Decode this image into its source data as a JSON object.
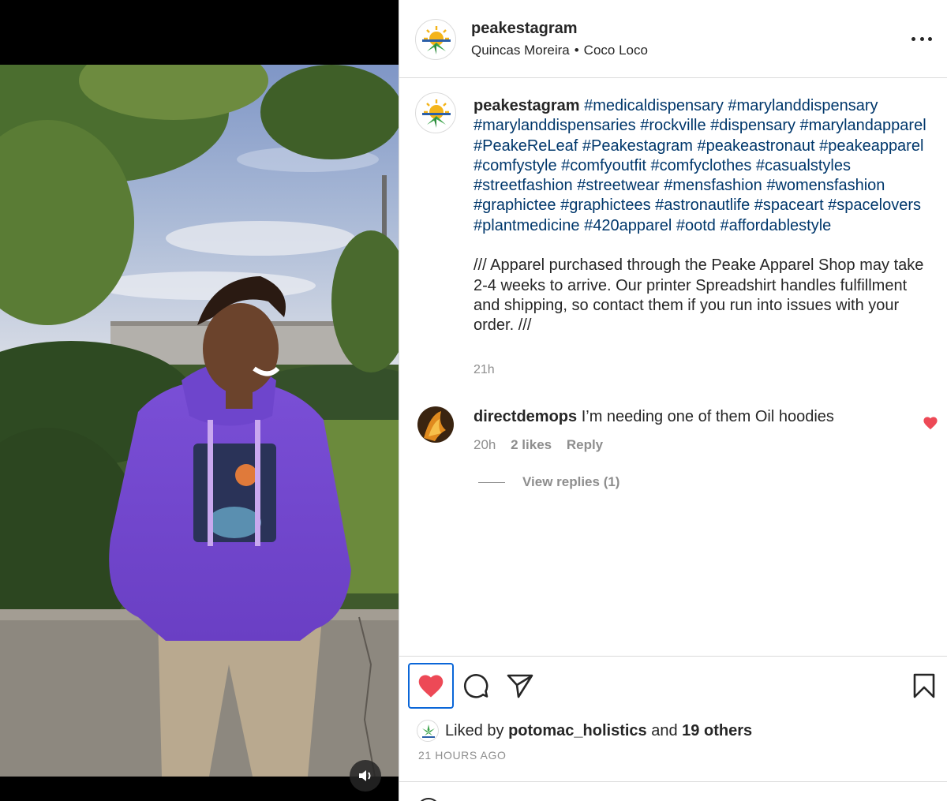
{
  "post": {
    "username": "peakestagram",
    "location_parts": [
      "Quincas Moreira",
      "Coco Loco"
    ],
    "location_separator": "•",
    "media_alt": "Person in purple hoodie leaning on a wall outdoors"
  },
  "caption": {
    "username": "peakestagram",
    "hashtags": "#medicaldispensary #marylanddispensary #marylanddispensaries #rockville #dispensary #marylandapparel #PeakeReLeaf #Peakestagram #peakeastronaut #peakeapparel #comfystyle #comfyoutfit #comfyclothes #casualstyles #streetfashion #streetwear #mensfashion #womensfashion #graphictee #graphictees #astronautlife #spaceart #spacelovers #plantmedicine #420apparel #ootd #affordablestyle",
    "body": "/// Apparel purchased through the Peake Apparel Shop may take 2-4 weeks to arrive. Our printer Spreadshirt handles fulfillment and shipping, so contact them if you run into issues with your order. ///",
    "time": "21h"
  },
  "comment": {
    "username": "directdemops",
    "text": "I’m needing one of them Oil hoodies",
    "time": "20h",
    "likes": "2 likes",
    "reply_label": "Reply",
    "view_replies": "View replies (1)"
  },
  "actions": {
    "liked_prefix": "Liked by",
    "liked_user": "potomac_holistics",
    "liked_and": "and",
    "liked_others": "19 others",
    "date": "21 HOURS AGO"
  },
  "icons": [
    "more-options-icon",
    "heart-icon",
    "comment-icon",
    "share-icon",
    "bookmark-icon",
    "speaker-icon"
  ],
  "colors": {
    "like_red": "#ed4956",
    "hashtag_blue": "#00376b",
    "focus_outline": "#0a66d8",
    "secondary_text": "#8e8e8e"
  }
}
